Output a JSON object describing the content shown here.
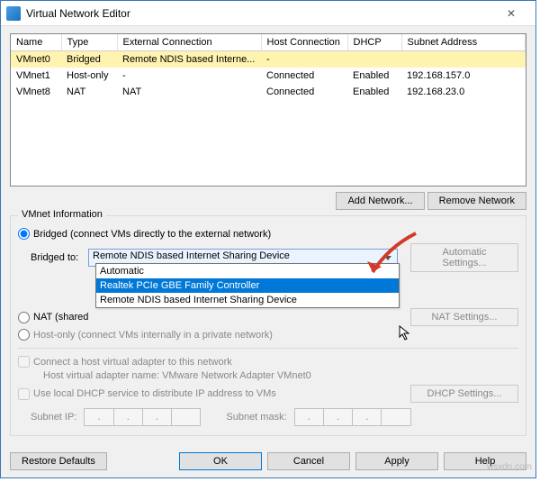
{
  "window": {
    "title": "Virtual Network Editor"
  },
  "table": {
    "headers": [
      "Name",
      "Type",
      "External Connection",
      "Host Connection",
      "DHCP",
      "Subnet Address"
    ],
    "rows": [
      {
        "name": "VMnet0",
        "type": "Bridged",
        "ext": "Remote NDIS based Interne...",
        "host": "-",
        "dhcp": "",
        "subnet": "",
        "selected": true
      },
      {
        "name": "VMnet1",
        "type": "Host-only",
        "ext": "-",
        "host": "Connected",
        "dhcp": "Enabled",
        "subnet": "192.168.157.0"
      },
      {
        "name": "VMnet8",
        "type": "NAT",
        "ext": "NAT",
        "host": "Connected",
        "dhcp": "Enabled",
        "subnet": "192.168.23.0"
      }
    ]
  },
  "buttons": {
    "add_network": "Add Network...",
    "remove_network": "Remove Network",
    "automatic_settings": "Automatic Settings...",
    "nat_settings": "NAT Settings...",
    "dhcp_settings": "DHCP Settings...",
    "restore": "Restore Defaults",
    "ok": "OK",
    "cancel": "Cancel",
    "apply": "Apply",
    "help": "Help"
  },
  "groupbox": {
    "title": "VMnet Information",
    "bridged_label": "Bridged (connect VMs directly to the external network)",
    "nat_label": "NAT (shared",
    "hostonly_label": "Host-only (connect VMs internally in a private network)",
    "bridged_to": "Bridged to:",
    "selected_adapter": "Remote NDIS based Internet Sharing Device",
    "options": [
      "Automatic",
      "Realtek PCIe GBE Family Controller",
      "Remote NDIS based Internet Sharing Device"
    ],
    "connect_host": "Connect a host virtual adapter to this network",
    "host_adapter_hint": "Host virtual adapter name: VMware Network Adapter VMnet0",
    "use_dhcp": "Use local DHCP service to distribute IP address to VMs",
    "subnet_ip": "Subnet IP:",
    "subnet_mask": "Subnet mask:"
  },
  "watermark": "wsxdn.com"
}
